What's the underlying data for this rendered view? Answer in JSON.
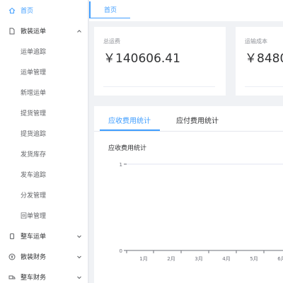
{
  "sidebar": {
    "home": "首页",
    "groups": [
      {
        "label": "散装运单",
        "expanded": true,
        "items": [
          "运单追踪",
          "运单管理",
          "新增运单",
          "提货管理",
          "提货追踪",
          "发货库存",
          "发车追踪",
          "分发管理",
          "回单管理"
        ]
      },
      {
        "label": "整车运单",
        "expanded": false
      },
      {
        "label": "散装财务",
        "expanded": false
      },
      {
        "label": "整车财务",
        "expanded": false
      }
    ]
  },
  "tabs": {
    "home": "首页"
  },
  "cards": [
    {
      "title": "总运费",
      "value": "￥140606.41"
    },
    {
      "title": "运输成本",
      "value": "￥8480"
    }
  ],
  "panel": {
    "tabs": [
      "应收费用统计",
      "应付费用统计"
    ],
    "active_tab": 0
  },
  "colors": {
    "accent": "#409eff",
    "text": "#303133",
    "muted": "#909399"
  },
  "chart_data": {
    "type": "line",
    "title": "应收费用统计",
    "categories": [
      "1月",
      "2月",
      "3月",
      "4月",
      "5月",
      "6月"
    ],
    "ylim": [
      0,
      1
    ],
    "yticks": [
      "0",
      "1"
    ],
    "series": []
  }
}
